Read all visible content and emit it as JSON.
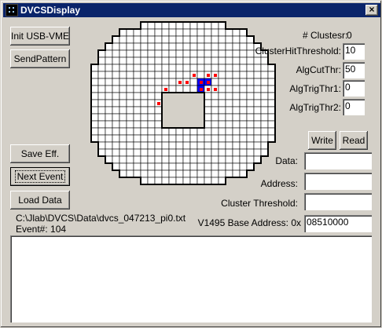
{
  "window": {
    "title": "DVCSDisplay",
    "close_glyph": "×"
  },
  "buttons": {
    "init_usb": "Init USB-VME",
    "send_pattern": "SendPattern",
    "save_eff": "Save Eff.",
    "next_event": "Next Event",
    "load_data": "Load Data",
    "write": "Write",
    "read": "Read"
  },
  "params": {
    "clusters_label": "# Clustesr:",
    "clusters_value": "0",
    "cluster_hit_threshold_label": "ClusterHitThreshold:",
    "cluster_hit_threshold_value": "10",
    "alg_cut_thr_label": "AlgCutThr:",
    "alg_cut_thr_value": "50",
    "alg_trig_thr1_label": "AlgTrigThr1:",
    "alg_trig_thr1_value": "0",
    "alg_trig_thr2_label": "AlgTrigThr2:",
    "alg_trig_thr2_value": "0"
  },
  "vme": {
    "data_label": "Data:",
    "data_value": "",
    "address_label": "Address:",
    "address_value": "",
    "cluster_threshold_label": "Cluster Threshold:",
    "cluster_threshold_value": "",
    "base_address_label": "V1495 Base Address: 0x",
    "base_address_value": "08510000"
  },
  "status": {
    "file_path": "C:\\Jlab\\DVCS\\Data\\dvcs_047213_pi0.txt",
    "event_label": "Event#: 104"
  },
  "log": {
    "text": ""
  },
  "calorimeter": {
    "columns": 26,
    "rows": 23,
    "row_extents": [
      [
        7,
        18
      ],
      [
        4,
        21
      ],
      [
        3,
        22
      ],
      [
        2,
        23
      ],
      [
        1,
        24
      ],
      [
        1,
        24
      ],
      [
        0,
        25
      ],
      [
        0,
        25
      ],
      [
        0,
        25
      ],
      [
        0,
        25
      ],
      [
        0,
        25
      ],
      [
        0,
        25
      ],
      [
        0,
        25
      ],
      [
        0,
        25
      ],
      [
        0,
        25
      ],
      [
        0,
        25
      ],
      [
        0,
        25
      ],
      [
        1,
        24
      ],
      [
        1,
        24
      ],
      [
        2,
        23
      ],
      [
        3,
        22
      ],
      [
        4,
        21
      ],
      [
        7,
        18
      ]
    ],
    "hole": {
      "row_start": 10,
      "row_end": 14,
      "col_start": 10,
      "col_end": 15
    },
    "hit_color": "#ff0000",
    "cluster_color": "#0000ff",
    "hits": [
      [
        7,
        14
      ],
      [
        7,
        16
      ],
      [
        7,
        17
      ],
      [
        8,
        12
      ],
      [
        8,
        13
      ],
      [
        9,
        10
      ],
      [
        9,
        16
      ],
      [
        9,
        17
      ],
      [
        10,
        14
      ],
      [
        11,
        9
      ],
      [
        12,
        14
      ],
      [
        14,
        11
      ]
    ],
    "cluster": [
      [
        8,
        15
      ],
      [
        8,
        16
      ],
      [
        9,
        15
      ]
    ]
  }
}
